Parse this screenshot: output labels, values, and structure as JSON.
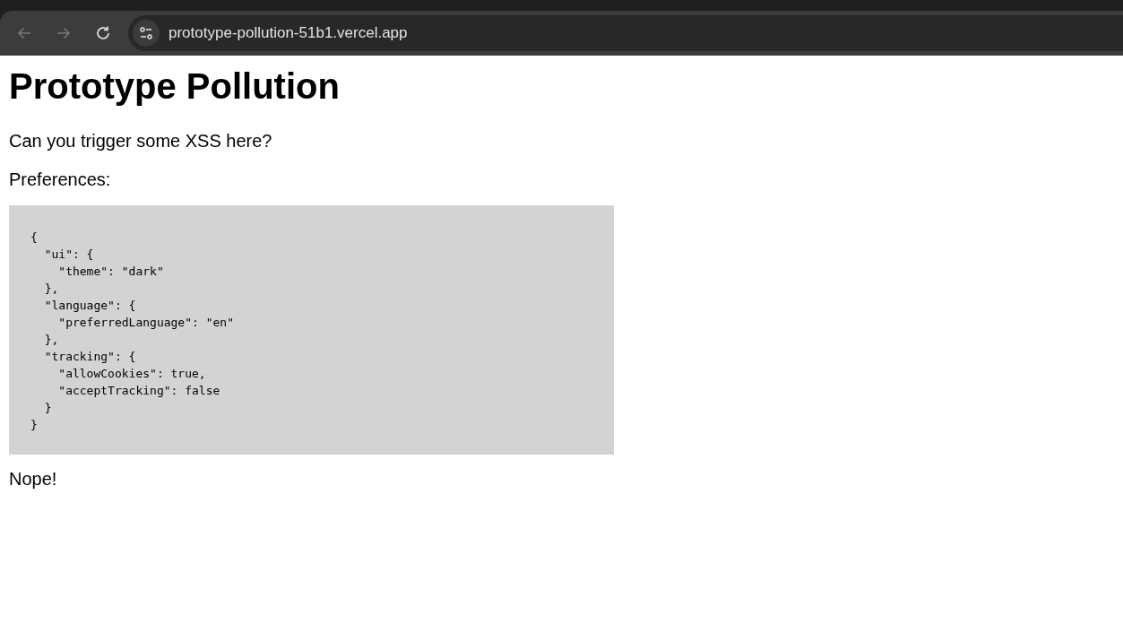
{
  "browser": {
    "back": {
      "disabled": true
    },
    "forward": {
      "disabled": true
    },
    "url": "prototype-pollution-51b1.vercel.app"
  },
  "page": {
    "title": "Prototype Pollution",
    "intro": "Can you trigger some XSS here?",
    "preferences_label": "Preferences:",
    "code_lines": [
      "{",
      "  \"ui\": {",
      "    \"theme\": \"dark\"",
      "  },",
      "  \"language\": {",
      "    \"preferredLanguage\": \"en\"",
      "  },",
      "  \"tracking\": {",
      "    \"allowCookies\": true,",
      "    \"acceptTracking\": false",
      "  }",
      "}"
    ],
    "result": "Nope!"
  }
}
